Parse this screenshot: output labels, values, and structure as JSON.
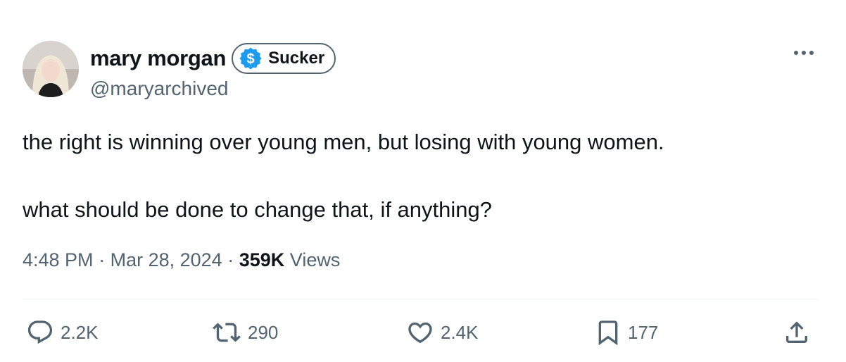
{
  "author": {
    "display_name": "mary morgan",
    "handle": "@maryarchived",
    "badge_label": "Sucker",
    "badge_icon": "dollar-icon",
    "badge_color": "#1d9bf0"
  },
  "tweet": {
    "paragraphs": [
      "the right is winning over young men, but losing with young women.",
      "what should be done to change that, if anything?"
    ],
    "time": "4:48 PM",
    "separator": "·",
    "date": "Mar 28, 2024",
    "views_count": "359K",
    "views_label": "Views"
  },
  "actions": {
    "replies": "2.2K",
    "retweets": "290",
    "likes": "2.4K",
    "bookmarks": "177"
  },
  "colors": {
    "text": "#0f1419",
    "muted": "#536471",
    "divider": "#eff3f4"
  }
}
